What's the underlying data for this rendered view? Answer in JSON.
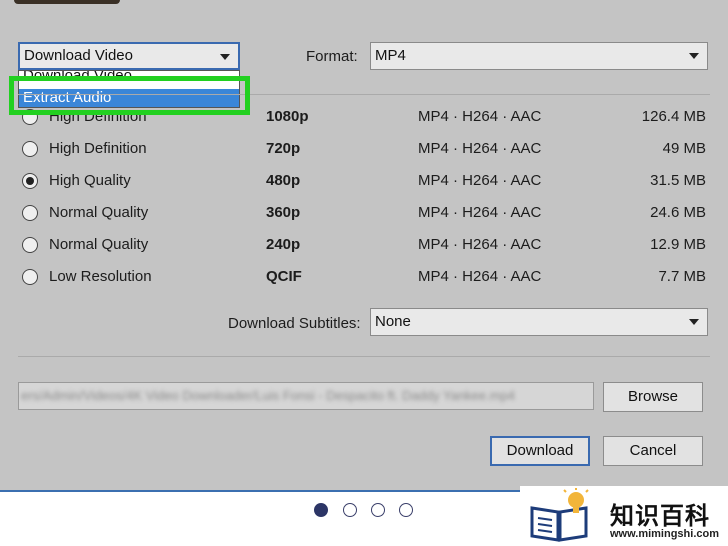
{
  "download_mode": {
    "selected": "Download Video",
    "options": [
      "Download Video",
      "Extract Audio"
    ],
    "highlighted_option": "Extract Audio"
  },
  "format": {
    "label": "Format:",
    "value": "MP4"
  },
  "qualities": [
    {
      "name": "High Definition",
      "resolution": "1080p",
      "codec": "MP4 · H264 · AAC",
      "size": "126.4 MB",
      "selected": false
    },
    {
      "name": "High Definition",
      "resolution": "720p",
      "codec": "MP4 · H264 · AAC",
      "size": "49 MB",
      "selected": false
    },
    {
      "name": "High Quality",
      "resolution": "480p",
      "codec": "MP4 · H264 · AAC",
      "size": "31.5 MB",
      "selected": true
    },
    {
      "name": "Normal Quality",
      "resolution": "360p",
      "codec": "MP4 · H264 · AAC",
      "size": "24.6 MB",
      "selected": false
    },
    {
      "name": "Normal Quality",
      "resolution": "240p",
      "codec": "MP4 · H264 · AAC",
      "size": "12.9 MB",
      "selected": false
    },
    {
      "name": "Low Resolution",
      "resolution": "QCIF",
      "codec": "MP4 · H264 · AAC",
      "size": "7.7 MB",
      "selected": false
    }
  ],
  "subtitles": {
    "label": "Download Subtitles:",
    "value": "None"
  },
  "save_path": {
    "value": "ers/Admin/Videos/4K Video Downloader/Luis Fonsi - Despacito ft. Daddy Yankee.mp4"
  },
  "buttons": {
    "browse": "Browse",
    "download": "Download",
    "cancel": "Cancel"
  },
  "pager": {
    "total": 4,
    "active": 1
  },
  "watermark": {
    "text": "知识百科",
    "url": "www.mimingshi.com"
  },
  "colors": {
    "highlight": "#22d020",
    "selection": "#3a86d8",
    "dialog_bg": "#c4c4c4"
  }
}
